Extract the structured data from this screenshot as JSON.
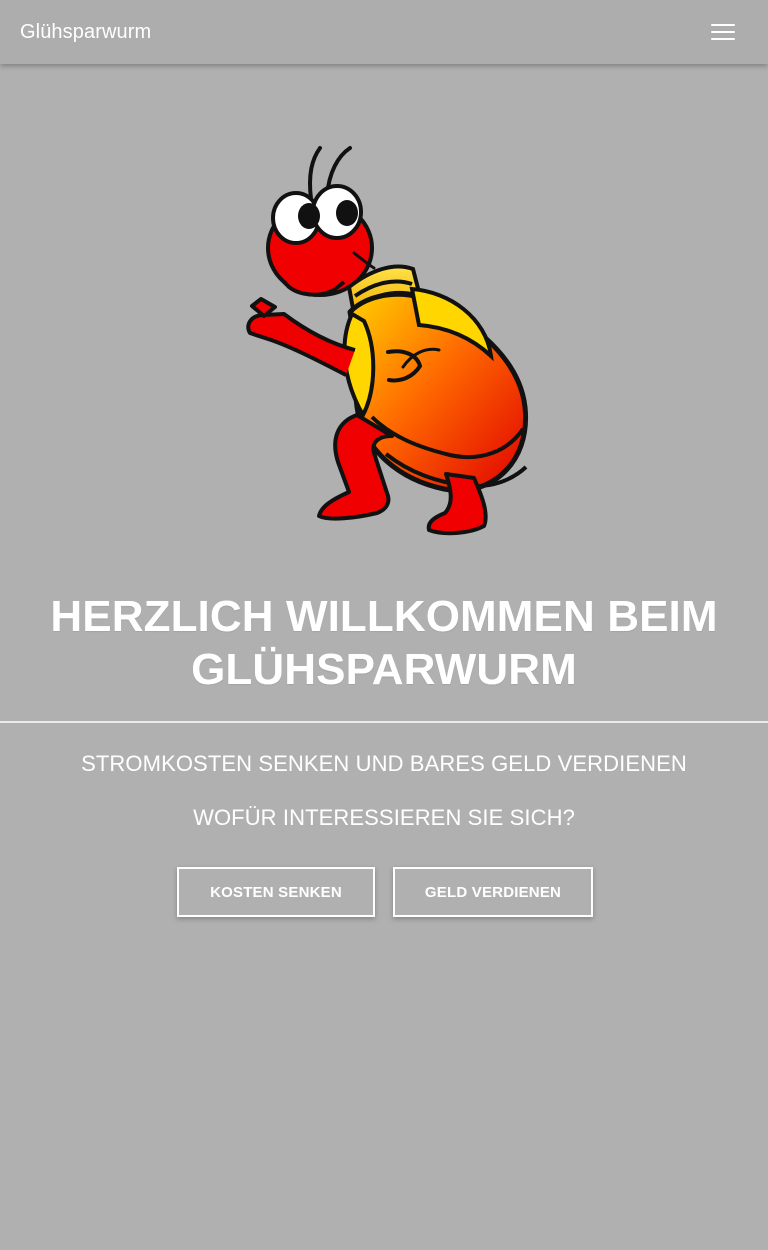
{
  "header": {
    "brand": "Glühsparwurm",
    "menu_icon": "hamburger-menu-icon"
  },
  "hero": {
    "mascot_icon": "glowworm-lightbulb-mascot",
    "headline_line1": "HERZLICH WILLKOMMEN BEIM",
    "headline_line2": "GLÜHSPARWURM",
    "subheadline": "STROMKOSTEN SENKEN UND BARES GELD VERDIENEN",
    "question": "WOFÜR INTERESSIEREN SIE SICH?"
  },
  "actions": {
    "reduce_costs": "KOSTEN SENKEN",
    "earn_money": "GELD VERDIENEN"
  },
  "colors": {
    "background": "#B0B0B0",
    "text": "#FFFFFF",
    "mascot_red": "#F00000",
    "mascot_yellow": "#FFD600"
  }
}
